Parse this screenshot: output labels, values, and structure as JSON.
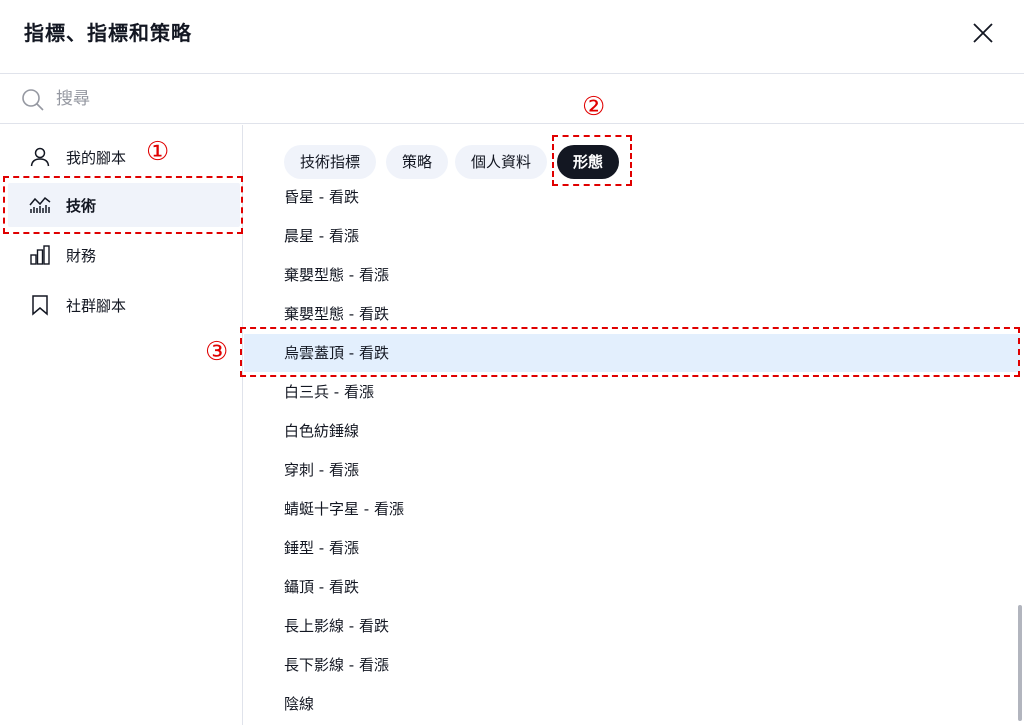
{
  "dialog": {
    "title": "指標、指標和策略",
    "close_icon": "close-icon"
  },
  "search": {
    "placeholder": "搜尋",
    "icon": "search-icon"
  },
  "sidebar": {
    "items": [
      {
        "label": "我的腳本",
        "icon": "user-icon",
        "active": false
      },
      {
        "label": "技術",
        "icon": "chart-icon",
        "active": true
      },
      {
        "label": "財務",
        "icon": "bar-chart-icon",
        "active": false
      },
      {
        "label": "社群腳本",
        "icon": "bookmark-icon",
        "active": false
      }
    ]
  },
  "tabs": [
    {
      "label": "技術指標",
      "active": false
    },
    {
      "label": "策略",
      "active": false
    },
    {
      "label": "個人資料",
      "active": false
    },
    {
      "label": "形態",
      "active": true
    }
  ],
  "patterns": [
    "昏星 - 看跌",
    "晨星 - 看漲",
    "棄嬰型態 - 看漲",
    "棄嬰型態 - 看跌",
    "烏雲蓋頂 - 看跌",
    "白三兵 - 看漲",
    "白色紡錘線",
    "穿刺 - 看漲",
    "蜻蜓十字星 - 看漲",
    "錘型 - 看漲",
    "鑷頂 - 看跌",
    "長上影線 - 看跌",
    "長下影線 - 看漲",
    "陰線"
  ],
  "highlighted_pattern": "烏雲蓋頂 - 看跌",
  "annotations": {
    "n1": "①",
    "n2": "②",
    "n3": "③"
  },
  "colors": {
    "accent_dark": "#131722",
    "chip_bg": "#f0f3fa",
    "highlight_bg": "#e3effd",
    "annotation": "#e00000"
  }
}
